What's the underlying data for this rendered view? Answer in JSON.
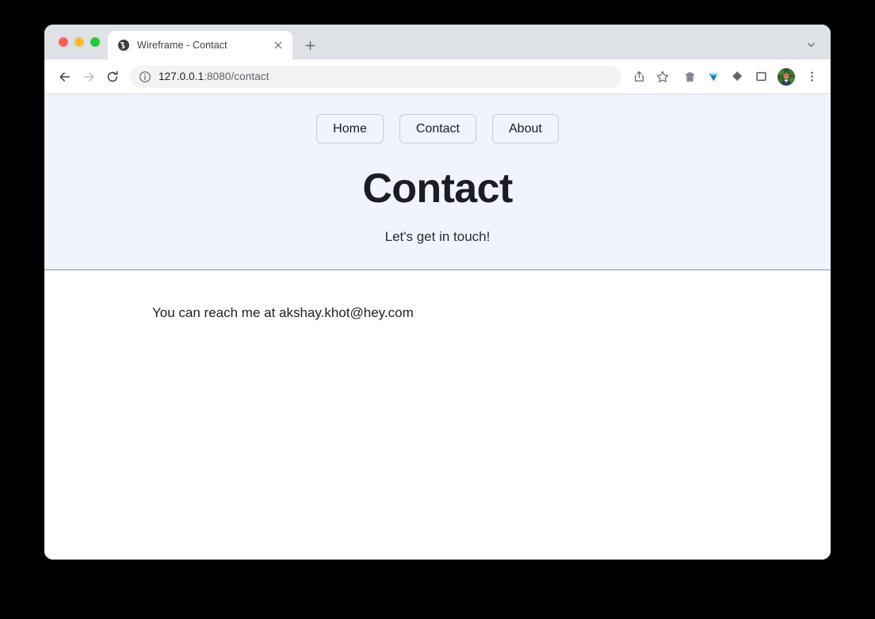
{
  "browser": {
    "window_controls": [
      "close",
      "minimize",
      "maximize"
    ],
    "tab": {
      "title": "Wireframe - Contact",
      "favicon": "globe-icon",
      "close_label": "×"
    },
    "new_tab_label": "+",
    "tab_list_icon": "chevron-down-icon",
    "toolbar": {
      "back_icon": "back-arrow-icon",
      "forward_icon": "forward-arrow-icon",
      "reload_icon": "reload-icon",
      "site_info_icon": "info-circle-icon",
      "url_host": "127.0.0.1",
      "url_path": ":8080/contact",
      "url_full": "127.0.0.1:8080/contact",
      "icons": [
        "share-icon",
        "bookmark-star-icon",
        "trash-icon",
        "gem-icon",
        "extensions-puzzle-icon",
        "side-panel-icon"
      ],
      "avatar": "profile-avatar",
      "menu_icon": "three-dot-menu-icon"
    }
  },
  "page": {
    "nav": [
      {
        "label": "Home"
      },
      {
        "label": "Contact"
      },
      {
        "label": "About"
      }
    ],
    "hero": {
      "title": "Contact",
      "subtitle": "Let's get in touch!"
    },
    "body": {
      "text": "You can reach me at akshay.khot@hey.com"
    }
  },
  "colors": {
    "hero_background": "#f1f4fd",
    "hero_border": "#8b92ab",
    "tabstrip_background": "#dee1e6",
    "omnibox_background": "#f1f3f4",
    "traffic_red": "#ff5f57",
    "traffic_amber": "#febc2e",
    "traffic_green": "#28c840",
    "gem_icon": "#1a9cf0",
    "page_background": "#ffffff",
    "desktop_background": "#000000"
  }
}
